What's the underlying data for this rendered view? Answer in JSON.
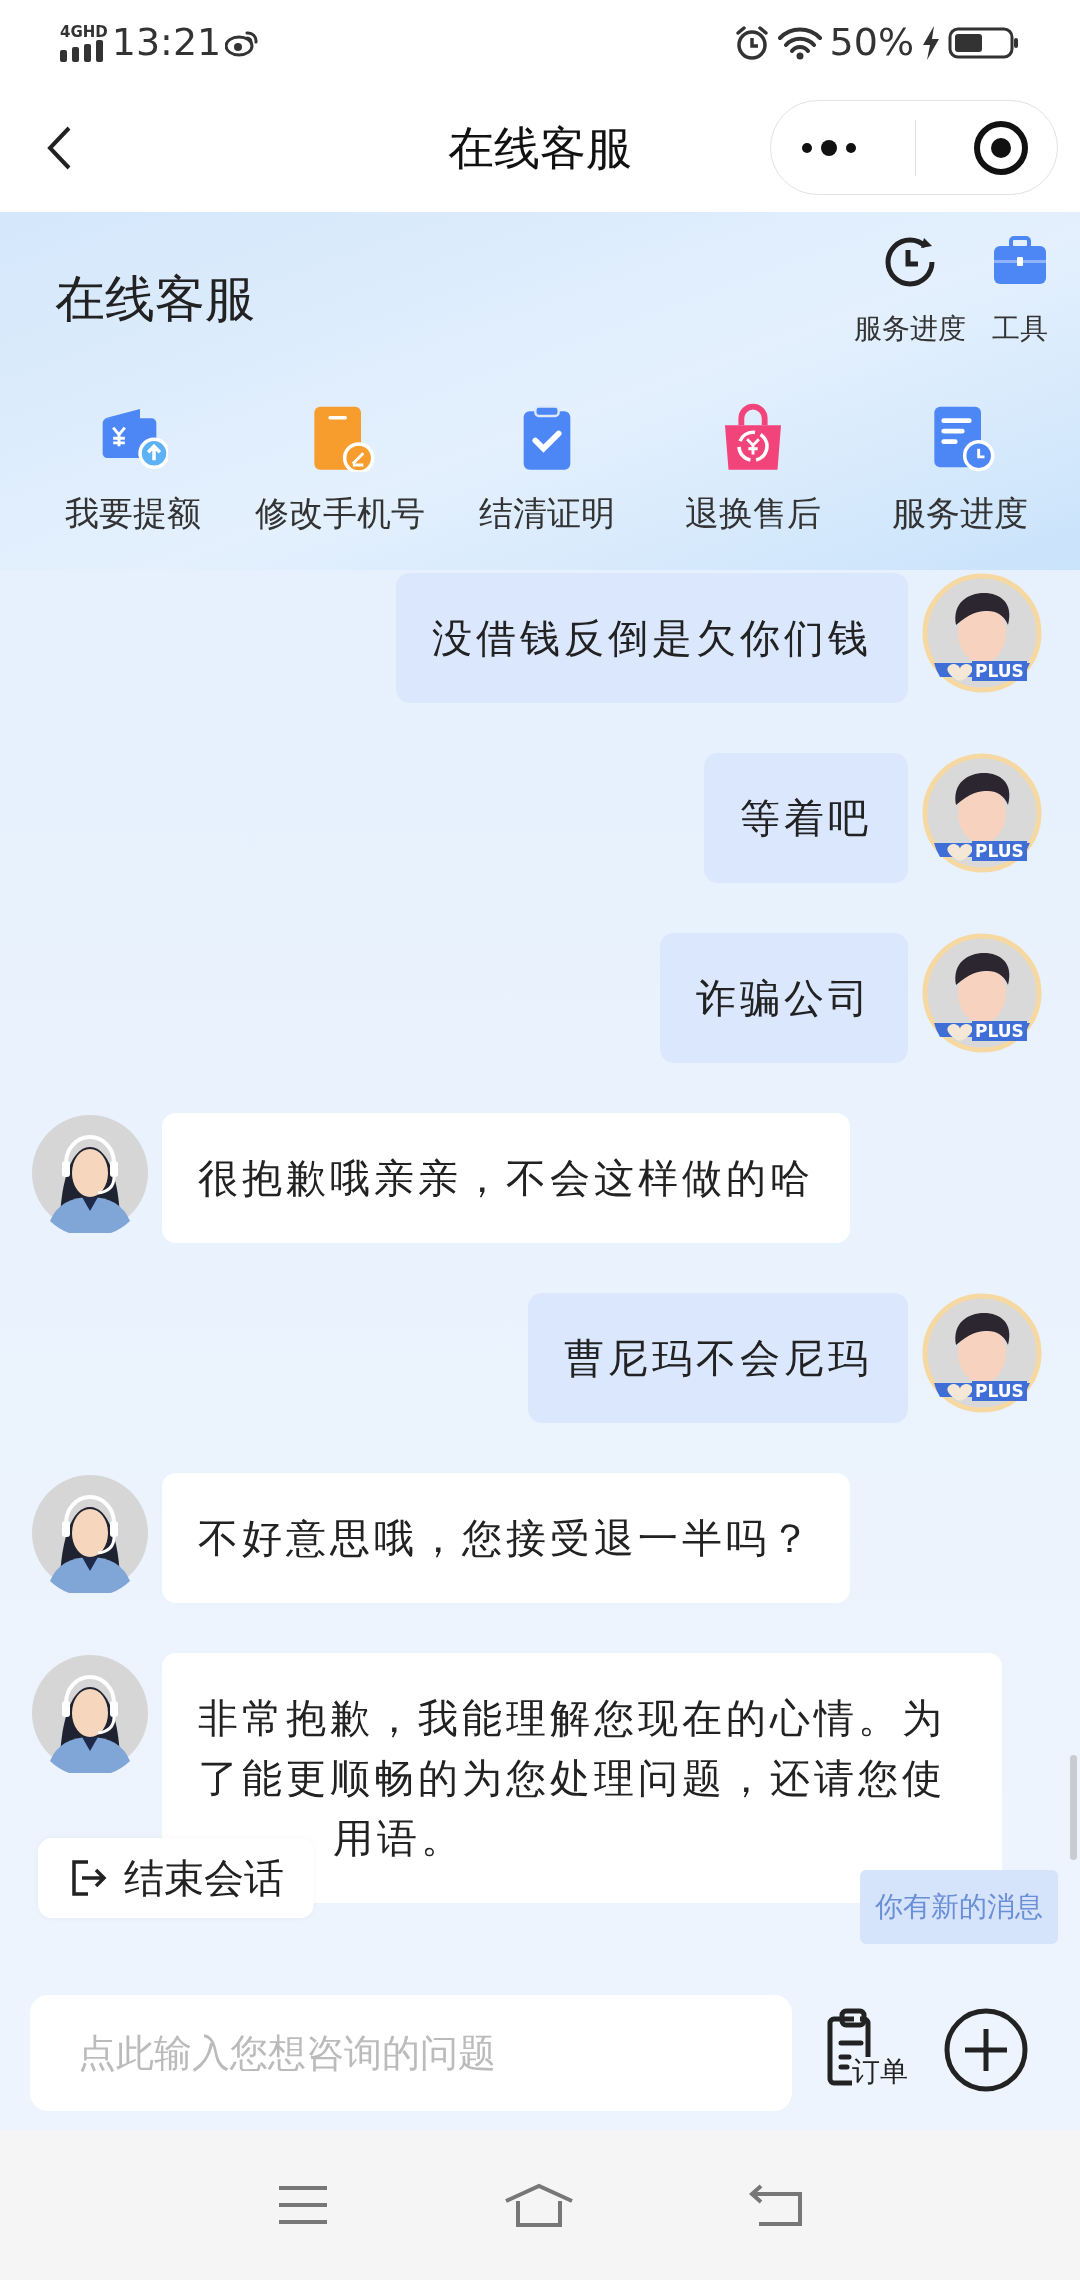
{
  "status_bar": {
    "network": "4GHD",
    "time": "13:21",
    "battery": "50%"
  },
  "header": {
    "title": "在线客服"
  },
  "panel": {
    "title": "在线客服",
    "top_actions": [
      {
        "label": "服务进度",
        "kind": "clock"
      },
      {
        "label": "工具",
        "kind": "toolbox"
      }
    ],
    "shortcuts": [
      {
        "label": "我要提额",
        "kind": "wallet"
      },
      {
        "label": "修改手机号",
        "kind": "phone"
      },
      {
        "label": "结清证明",
        "kind": "clipboard"
      },
      {
        "label": "退换售后",
        "kind": "bag"
      },
      {
        "label": "服务进度",
        "kind": "document"
      }
    ]
  },
  "messages": [
    {
      "kind": "user",
      "text": "没借钱反倒是欠你们钱",
      "avatar_badge": "PLUS"
    },
    {
      "kind": "user",
      "text": "等着吧",
      "avatar_badge": "PLUS"
    },
    {
      "kind": "user",
      "text": "诈骗公司",
      "avatar_badge": "PLUS"
    },
    {
      "kind": "agent",
      "text": "很抱歉哦亲亲，不会这样做的哈"
    },
    {
      "kind": "user",
      "text": "曹尼玛不会尼玛",
      "avatar_badge": "PLUS"
    },
    {
      "kind": "agent",
      "text": "不好意思哦，您接受退一半吗？"
    },
    {
      "kind": "agent",
      "text": "非常抱歉，我能理解您现在的心情。为了能更顺畅的为您处理问题，还请您使",
      "text_tail": "用语。"
    }
  ],
  "end_session": {
    "label": "结束会话"
  },
  "new_message_notice": "你有新的消息",
  "input": {
    "placeholder": "点此输入您想咨询的问题"
  },
  "order_button": {
    "label": "订单"
  }
}
